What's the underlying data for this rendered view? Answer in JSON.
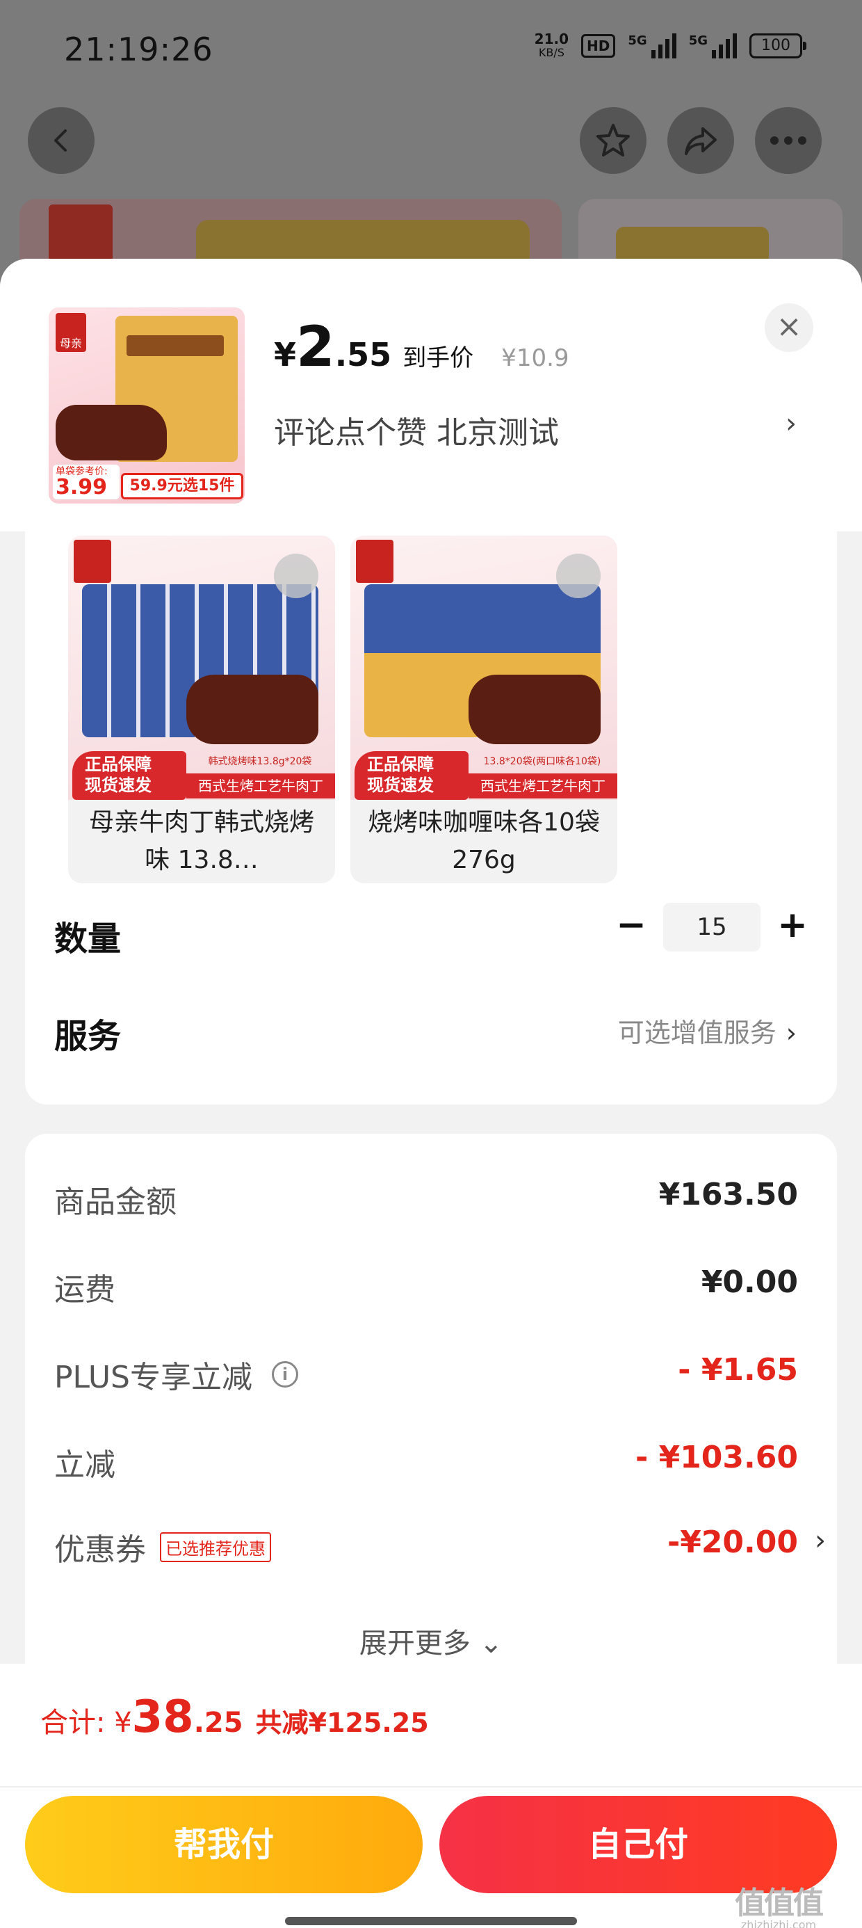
{
  "status_bar": {
    "time": "21:19:26",
    "net_speed": "21.0",
    "net_unit": "KB/S",
    "hd": "HD",
    "signal1": "5G",
    "signal2": "5G",
    "battery": "100"
  },
  "nav": {
    "back_icon": "chevron-left-icon",
    "fav_icon": "star-icon",
    "share_icon": "share-icon",
    "more_icon": "more-dots-icon"
  },
  "product": {
    "yen": "¥",
    "price_int": "2",
    "price_dec": ".55",
    "price_tag": "到手价",
    "orig_price": "¥10.9",
    "spec": "评论点个赞  北京测试",
    "thumb_ref_label": "单袋参考价:",
    "thumb_ref_price": "3.99",
    "thumb_ref_unit": "元",
    "thumb_promo": "59.9元选15件",
    "thumb_logo": "母亲"
  },
  "variants": [
    {
      "name": "母亲牛肉丁韩式烧烤味 13.8…",
      "guarantee1": "正品保障",
      "guarantee2": "现货速发",
      "desc": "韩式烧烤味13.8g*20袋",
      "sub": "西式生烤工艺牛肉丁"
    },
    {
      "name": "烧烤味咖喱味各10袋 276g",
      "guarantee1": "正品保障",
      "guarantee2": "现货速发",
      "desc": "13.8*20袋(两口味各10袋)",
      "sub": "西式生烤工艺牛肉丁"
    }
  ],
  "quantity": {
    "label": "数量",
    "minus": "−",
    "value": "15",
    "plus": "+"
  },
  "service": {
    "label": "服务",
    "value": "可选增值服务",
    "chevron": "›"
  },
  "fees": [
    {
      "label": "商品金额",
      "value": "¥163.50",
      "red": false
    },
    {
      "label": "运费",
      "value": "¥0.00",
      "red": false
    },
    {
      "label": "PLUS专享立减",
      "value": "- ¥1.65",
      "red": true,
      "info": "i"
    },
    {
      "label": "立减",
      "value": "- ¥103.60",
      "red": true
    },
    {
      "label": "优惠券",
      "value": "-¥20.00",
      "red": true,
      "tag": "已选推荐优惠",
      "chevron": "›"
    }
  ],
  "expand_more": "展开更多 ⌄",
  "footer": {
    "total_label": "合计: ¥",
    "total_int": "38",
    "total_dec": ".25",
    "total_save": "共减¥125.25",
    "btn_help": "帮我付",
    "btn_self": "自己付"
  },
  "watermark": {
    "text": "值值值",
    "sub": "zhizhizhi.com"
  },
  "colors": {
    "accent_red": "#e4251b",
    "btn_yellow": "#ffbb14",
    "btn_red": "#f53146"
  }
}
